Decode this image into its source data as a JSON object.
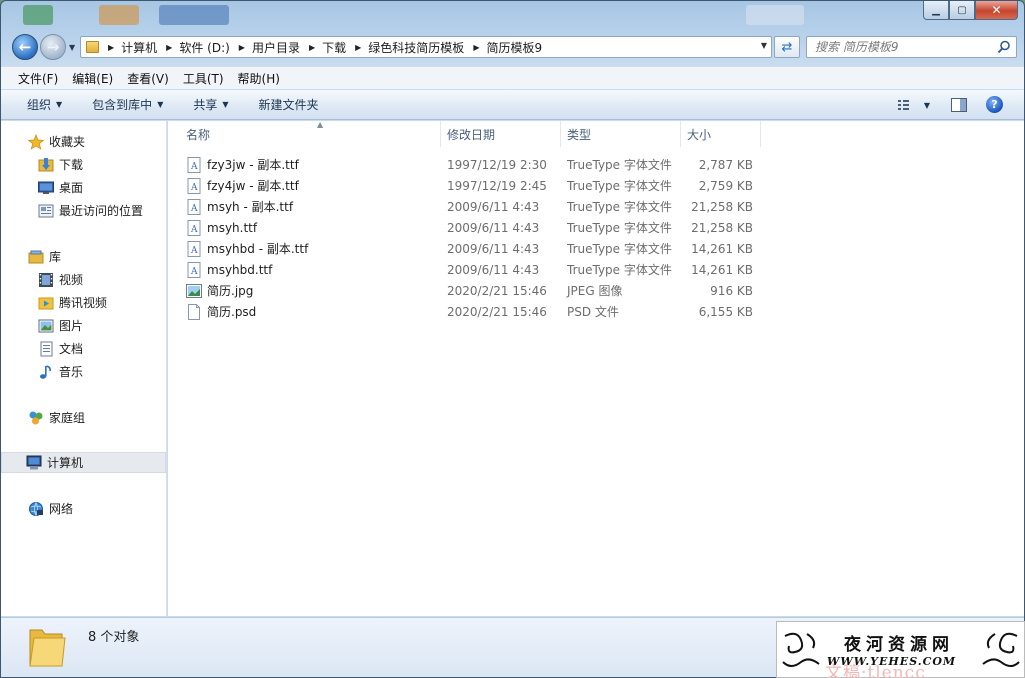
{
  "window": {
    "caption": {
      "minimize": "▁",
      "maximize": "▢",
      "close": "✕"
    }
  },
  "address": {
    "breadcrumbs": [
      "计算机",
      "软件 (D:)",
      "用户目录",
      "下载",
      "绿色科技简历模板",
      "简历模板9"
    ]
  },
  "search": {
    "placeholder": "搜索 简历模板9"
  },
  "menu": [
    "文件(F)",
    "编辑(E)",
    "查看(V)",
    "工具(T)",
    "帮助(H)"
  ],
  "commands": [
    {
      "label": "组织",
      "dropdown": true
    },
    {
      "label": "包含到库中",
      "dropdown": true
    },
    {
      "label": "共享",
      "dropdown": true
    },
    {
      "label": "新建文件夹",
      "dropdown": false
    }
  ],
  "nav": {
    "favorites": {
      "label": "收藏夹",
      "icon": "star-icon"
    },
    "favorite_items": [
      {
        "label": "下载",
        "icon": "downloads-folder-icon"
      },
      {
        "label": "桌面",
        "icon": "desktop-icon"
      },
      {
        "label": "最近访问的位置",
        "icon": "recent-places-icon"
      }
    ],
    "libraries": {
      "label": "库",
      "icon": "library-icon"
    },
    "library_items": [
      {
        "label": "视频",
        "icon": "video-library-icon"
      },
      {
        "label": "腾讯视频",
        "icon": "tencent-video-icon"
      },
      {
        "label": "图片",
        "icon": "pictures-library-icon"
      },
      {
        "label": "文档",
        "icon": "documents-library-icon"
      },
      {
        "label": "音乐",
        "icon": "music-library-icon"
      }
    ],
    "homegroup": {
      "label": "家庭组",
      "icon": "homegroup-icon"
    },
    "computer": {
      "label": "计算机",
      "icon": "computer-icon"
    },
    "network": {
      "label": "网络",
      "icon": "network-icon"
    }
  },
  "columns": {
    "name": "名称",
    "modified": "修改日期",
    "type": "类型",
    "size": "大小"
  },
  "files": [
    {
      "name": "fzy3jw - 副本.ttf",
      "modified": "1997/12/19 2:30",
      "type": "TrueType 字体文件",
      "size": "2,787 KB",
      "icon": "font-file-icon"
    },
    {
      "name": "fzy4jw - 副本.ttf",
      "modified": "1997/12/19 2:45",
      "type": "TrueType 字体文件",
      "size": "2,759 KB",
      "icon": "font-file-icon"
    },
    {
      "name": "msyh - 副本.ttf",
      "modified": "2009/6/11 4:43",
      "type": "TrueType 字体文件",
      "size": "21,258 KB",
      "icon": "font-file-icon"
    },
    {
      "name": "msyh.ttf",
      "modified": "2009/6/11 4:43",
      "type": "TrueType 字体文件",
      "size": "21,258 KB",
      "icon": "font-file-icon"
    },
    {
      "name": "msyhbd - 副本.ttf",
      "modified": "2009/6/11 4:43",
      "type": "TrueType 字体文件",
      "size": "14,261 KB",
      "icon": "font-file-icon"
    },
    {
      "name": "msyhbd.ttf",
      "modified": "2009/6/11 4:43",
      "type": "TrueType 字体文件",
      "size": "14,261 KB",
      "icon": "font-file-icon"
    },
    {
      "name": "简历.jpg",
      "modified": "2020/2/21 15:46",
      "type": "JPEG 图像",
      "size": "916 KB",
      "icon": "image-file-icon"
    },
    {
      "name": "简历.psd",
      "modified": "2020/2/21 15:46",
      "type": "PSD 文件",
      "size": "6,155 KB",
      "icon": "blank-file-icon"
    }
  ],
  "status": {
    "text": "8 个对象"
  },
  "watermark": {
    "title": "夜河资源网",
    "url": "WWW.YEHES.COM",
    "ghost": "文稿·tlencc"
  },
  "colors": {
    "accent": "#2c6fc0",
    "selected": "#e6e9ee",
    "folder": "#e8b93f"
  }
}
